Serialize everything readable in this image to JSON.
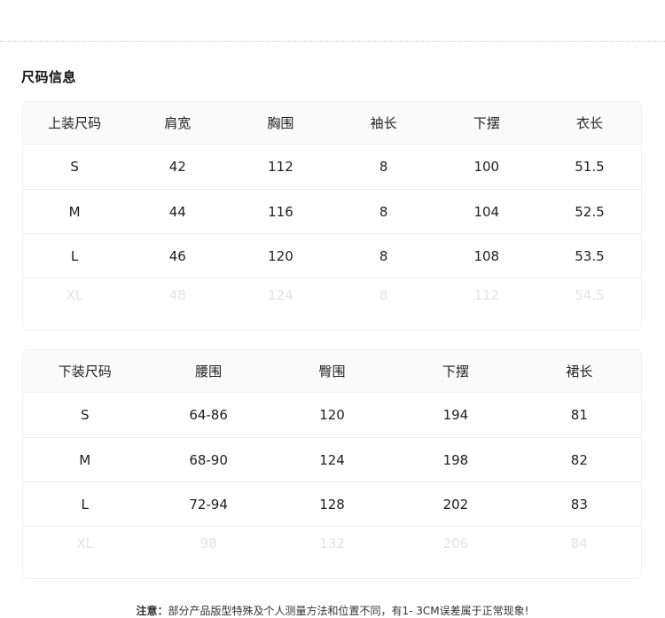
{
  "section_title": "尺码信息",
  "top_table": {
    "headers": [
      "上装尺码",
      "肩宽",
      "胸围",
      "袖长",
      "下摆",
      "衣长"
    ],
    "rows": [
      [
        "S",
        "42",
        "112",
        "8",
        "100",
        "51.5"
      ],
      [
        "M",
        "44",
        "116",
        "8",
        "104",
        "52.5"
      ],
      [
        "L",
        "46",
        "120",
        "8",
        "108",
        "53.5"
      ],
      [
        "XL",
        "48",
        "124",
        "8",
        "112",
        "54.5"
      ]
    ]
  },
  "bottom_table": {
    "headers": [
      "下装尺码",
      "腰围",
      "臀围",
      "下摆",
      "裙长"
    ],
    "rows": [
      [
        "S",
        "64-86",
        "120",
        "194",
        "81"
      ],
      [
        "M",
        "68-90",
        "124",
        "198",
        "82"
      ],
      [
        "L",
        "72-94",
        "128",
        "202",
        "83"
      ],
      [
        "XL",
        "98",
        "132",
        "206",
        "84"
      ]
    ]
  },
  "note": {
    "label": "注意：",
    "text": "部分产品版型特殊及个人测量方法和位置不同，有1- 3CM误差属于正常现象!"
  }
}
